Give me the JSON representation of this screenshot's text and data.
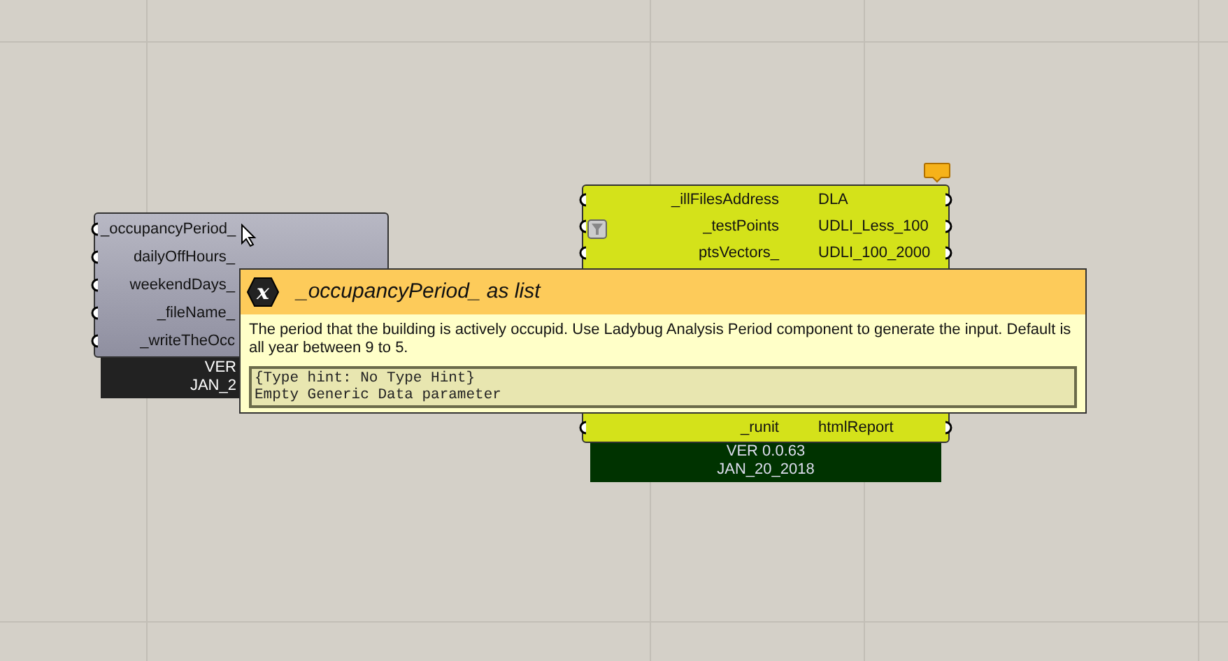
{
  "components": [
    {
      "inputs": [
        "_occupancyPeriod_",
        "dailyOffHours_",
        "weekendDays_",
        "_fileName_",
        "_writeTheOcc"
      ],
      "version": "VER",
      "date": "JAN_2",
      "kind": "gray"
    },
    {
      "inputs": [
        "_illFilesAddress",
        "_testPoints",
        "ptsVectors_",
        "_runit"
      ],
      "outputs": [
        "DLA",
        "UDLI_Less_100",
        "UDLI_100_2000",
        "htmlReport"
      ],
      "version": "VER 0.0.63",
      "date": "JAN_20_2018",
      "kind": "green"
    }
  ],
  "tooltip": {
    "icon": "x",
    "title": "_occupancyPeriod_ as list",
    "description": "The period that the building is actively occupid. Use Ladybug Analysis Period component to generate the input. Default is all year between 9 to 5.",
    "details": [
      "{Type hint: No Type Hint}",
      "Empty Generic Data parameter"
    ]
  }
}
